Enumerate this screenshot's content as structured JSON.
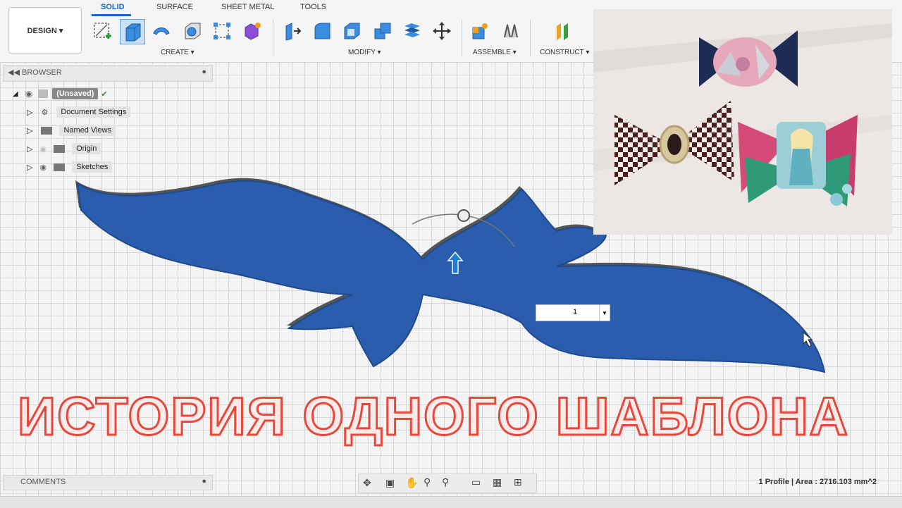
{
  "toolbar": {
    "workspace_button": "DESIGN ▾",
    "tabs": [
      "SOLID",
      "SURFACE",
      "SHEET METAL",
      "TOOLS"
    ],
    "groups": {
      "create": "CREATE ▾",
      "modify": "MODIFY ▾",
      "assemble": "ASSEMBLE ▾",
      "construct": "CONSTRUCT ▾"
    },
    "accent_color": "#0a6bd6"
  },
  "browser": {
    "title": "BROWSER",
    "items": [
      {
        "label": "(Unsaved)",
        "icon": "component-icon"
      },
      {
        "label": "Document Settings",
        "icon": "gear-icon"
      },
      {
        "label": "Named Views",
        "icon": "folder-icon"
      },
      {
        "label": "Origin",
        "icon": "folder-icon"
      },
      {
        "label": "Sketches",
        "icon": "folder-icon"
      }
    ]
  },
  "viewport": {
    "extrude_count_value": "1",
    "body_color": "#2a5dad"
  },
  "caption": {
    "text": "ИСТОРИЯ ОДНОГО ШАБЛОНА",
    "color": "#e8483a"
  },
  "comments": {
    "title": "COMMENTS"
  },
  "status": {
    "text": "1 Profile | Area : 2716.103 mm^2"
  },
  "photo": {
    "description_alt": ""
  }
}
